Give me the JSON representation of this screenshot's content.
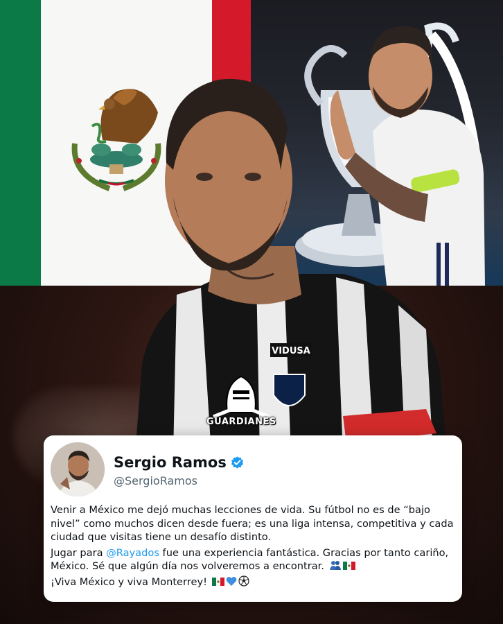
{
  "poster": {
    "logo_text": "GUARDIANES",
    "jersey_sponsor": "VIDUSA"
  },
  "tweet": {
    "name": "Sergio Ramos",
    "handle": "@SergioRamos",
    "verified": true,
    "paragraph1": "Venir a México me dejó muchas lecciones de vida. Su fútbol no es de “bajo nivel” como muchos dicen desde fuera; es una liga intensa, competitiva y cada ciudad que visitas tiene un desafío distinto.",
    "paragraph2_before": "Jugar para ",
    "mention": "@Rayados",
    "paragraph2_after": " fue una experiencia fantástica. Gracias por tanto cariño, México. Sé que algún día nos volveremos a encontrar.",
    "paragraph3": "¡Viva México y viva Monterrey!",
    "emoji_icons_p2": [
      "people-icon",
      "mexico-flag-icon"
    ],
    "emoji_icons_p3": [
      "mexico-flag-icon",
      "blue-heart-icon",
      "soccer-ball-icon"
    ]
  },
  "colors": {
    "flag_green": "#0b7a46",
    "flag_white": "#f7f7f5",
    "flag_red": "#d4192a",
    "verified_blue": "#1d9bf0",
    "mention_blue": "#1d9bf0"
  }
}
